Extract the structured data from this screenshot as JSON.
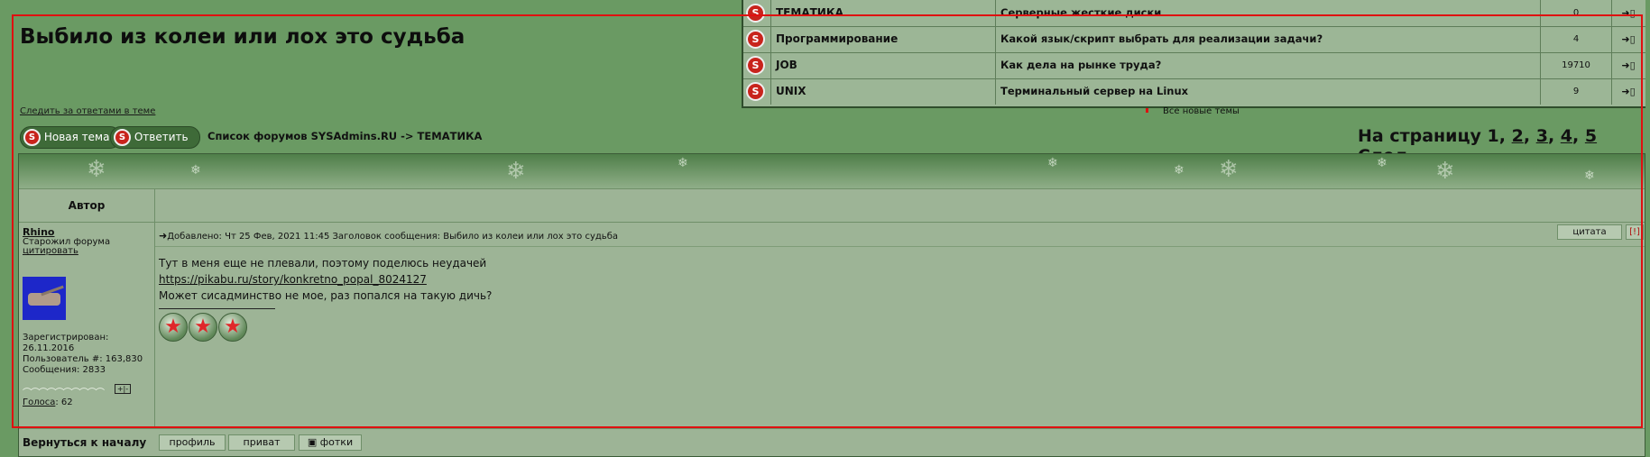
{
  "topic_title": "Выбило из колеи или лох это судьба",
  "watch_link": "Следить за ответами в теме",
  "new_topics": {
    "rows": [
      {
        "forum": "ТЕМАТИКА",
        "topic": "Серверные жесткие диски",
        "count": "0"
      },
      {
        "forum": "Программирование",
        "topic": "Какой язык/скрипт выбрать для реализации задачи?",
        "count": "4"
      },
      {
        "forum": "JOB",
        "topic": "Как дела на рынке труда?",
        "count": "19710"
      },
      {
        "forum": "UNIX",
        "topic": "Терминальный сервер на Linux",
        "count": "9"
      }
    ],
    "all_new_label": "Все новые темы"
  },
  "toolbar": {
    "new_topic_label": "Новая тема",
    "reply_label": "Ответить",
    "logo_letter": "S"
  },
  "breadcrumb": "Список форумов SYSAdmins.RU -> ТЕМАТИКА",
  "pager": {
    "prefix": "На страницу 1,",
    "pages": [
      "2",
      "3",
      "4",
      "5"
    ],
    "next_label": "След."
  },
  "post_table": {
    "author_header": "Автор",
    "author": {
      "name": "Rhino",
      "rank": "Старожил форума",
      "quote_link": "цитировать",
      "registered_label": "Зарегистрирован:",
      "registered_value": "26.11.2016",
      "user_id": "Пользователь #: 163,830",
      "messages": "Сообщения: 2833",
      "votes_label": "Голоса",
      "votes_value": ": 62"
    },
    "post": {
      "meta": "Добавлено: Чт 25 Фев, 2021 11:45     Заголовок сообщения: Выбило из колеи или лох это судьба",
      "quote_btn": "цитата",
      "report_btn": "[!]",
      "line1": "Тут в меня еще не плевали, поэтому поделюсь неудачей",
      "link": "https://pikabu.ru/story/konkretno_popal_8024127",
      "line3": "Может сисадминство не мое, раз попался на такую дичь?"
    },
    "footer": {
      "back_top": "Вернуться к началу",
      "profile_btn": "профиль",
      "private_btn": "приват",
      "photos_btn": "фотки"
    }
  },
  "colors": {
    "background": "#6a9a63",
    "table_bg": "#9db496",
    "highlight_box": "#e01010",
    "logo_red": "#c8241c"
  }
}
